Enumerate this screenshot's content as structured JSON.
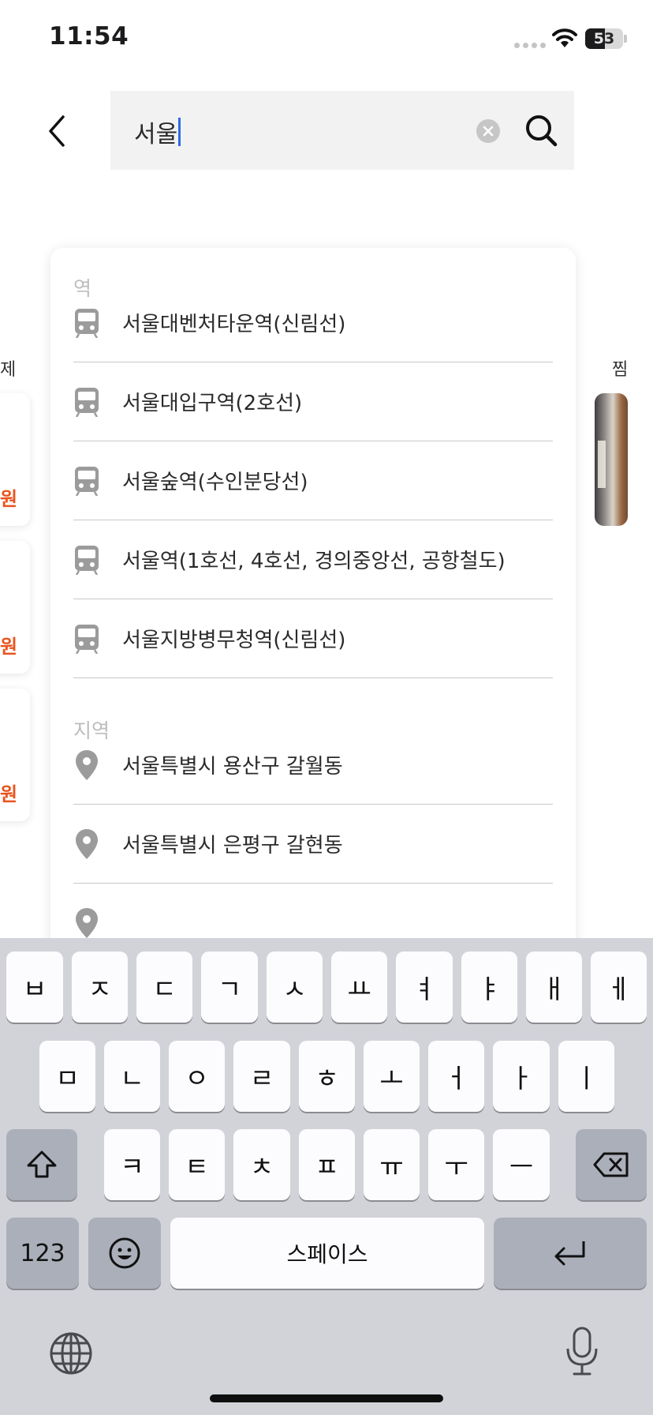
{
  "status_bar": {
    "time": "11:54",
    "battery": "53"
  },
  "search": {
    "query": "서울"
  },
  "background": {
    "left_label": "제",
    "right_label": "찜",
    "prices": [
      "원",
      "원",
      "원"
    ]
  },
  "suggestions": {
    "station_header": "역",
    "stations": [
      "서울대벤처타운역(신림선)",
      "서울대입구역(2호선)",
      "서울숲역(수인분당선)",
      "서울역(1호선, 4호선, 경의중앙선, 공항철도)",
      "서울지방병무청역(신림선)"
    ],
    "region_header": "지역",
    "regions": [
      "서울특별시 용산구 갈월동",
      "서울특별시 은평구 갈현동"
    ]
  },
  "keyboard": {
    "row1": [
      "ㅂ",
      "ㅈ",
      "ㄷ",
      "ㄱ",
      "ㅅ",
      "ㅛ",
      "ㅕ",
      "ㅑ",
      "ㅐ",
      "ㅔ"
    ],
    "row2": [
      "ㅁ",
      "ㄴ",
      "ㅇ",
      "ㄹ",
      "ㅎ",
      "ㅗ",
      "ㅓ",
      "ㅏ",
      "ㅣ"
    ],
    "row3": [
      "ㅋ",
      "ㅌ",
      "ㅊ",
      "ㅍ",
      "ㅠ",
      "ㅜ",
      "ㅡ"
    ],
    "numbers_label": "123",
    "space_label": "스페이스"
  }
}
